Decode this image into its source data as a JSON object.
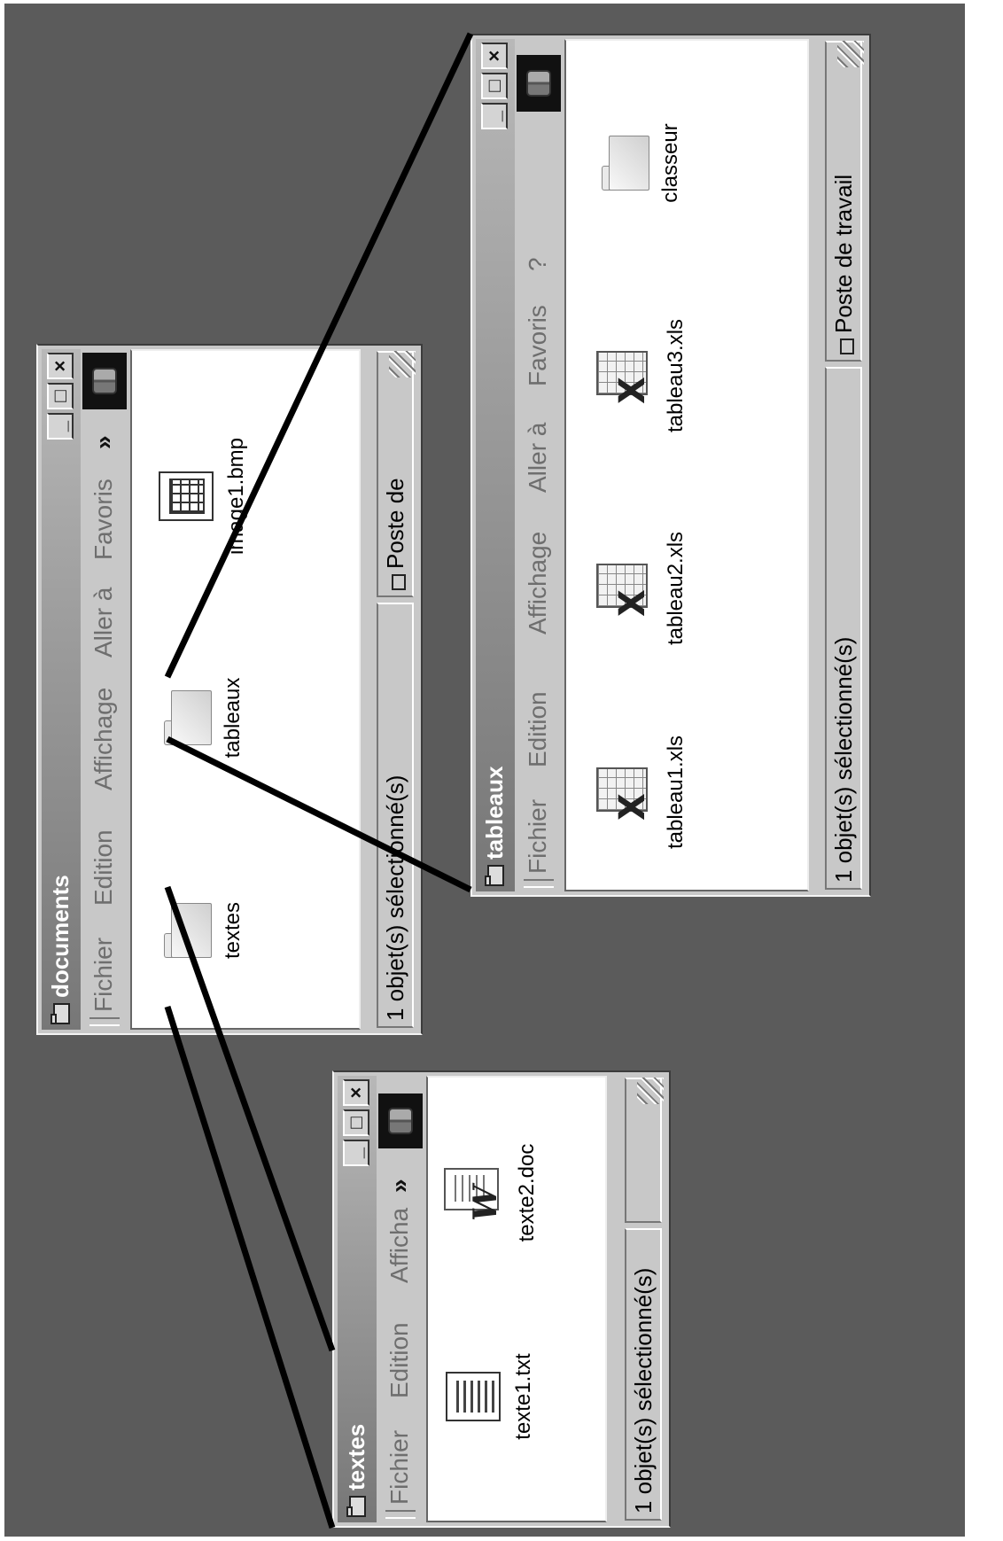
{
  "windows": {
    "documents": {
      "title": "documents",
      "menu": [
        "Fichier",
        "Edition",
        "Affichage",
        "Aller à",
        "Favoris"
      ],
      "more": "»",
      "items": [
        {
          "label": "textes",
          "icon": "folder-icon"
        },
        {
          "label": "tableaux",
          "icon": "folder-icon"
        },
        {
          "label": "image1.bmp",
          "icon": "bitmap-file-icon"
        }
      ],
      "status": "1 objet(s) sélectionné(s)",
      "zone": "Poste de"
    },
    "textes": {
      "title": "textes",
      "menu": [
        "Fichier",
        "Edition",
        "Afficha"
      ],
      "more": "»",
      "items": [
        {
          "label": "texte1.txt",
          "icon": "text-file-icon"
        },
        {
          "label": "texte2.doc",
          "icon": "word-document-icon"
        }
      ],
      "status": "1 objet(s) sélectionné(s)"
    },
    "tableaux": {
      "title": "tableaux",
      "menu": [
        "Fichier",
        "Edition",
        "Affichage",
        "Aller à",
        "Favoris",
        "?"
      ],
      "items": [
        {
          "label": "tableau1.xls",
          "icon": "excel-file-icon"
        },
        {
          "label": "tableau2.xls",
          "icon": "excel-file-icon"
        },
        {
          "label": "tableau3.xls",
          "icon": "excel-file-icon"
        },
        {
          "label": "classeur",
          "icon": "folder-icon"
        }
      ],
      "status": "1 objet(s) sélectionné(s)",
      "zone": "Poste de travail"
    }
  },
  "window_buttons": {
    "minimize": "_",
    "maximize": "□",
    "close": "×"
  },
  "colors": {
    "desktop": "#5b5b5b",
    "window": "#c8c8c8",
    "connector": "#000000"
  }
}
